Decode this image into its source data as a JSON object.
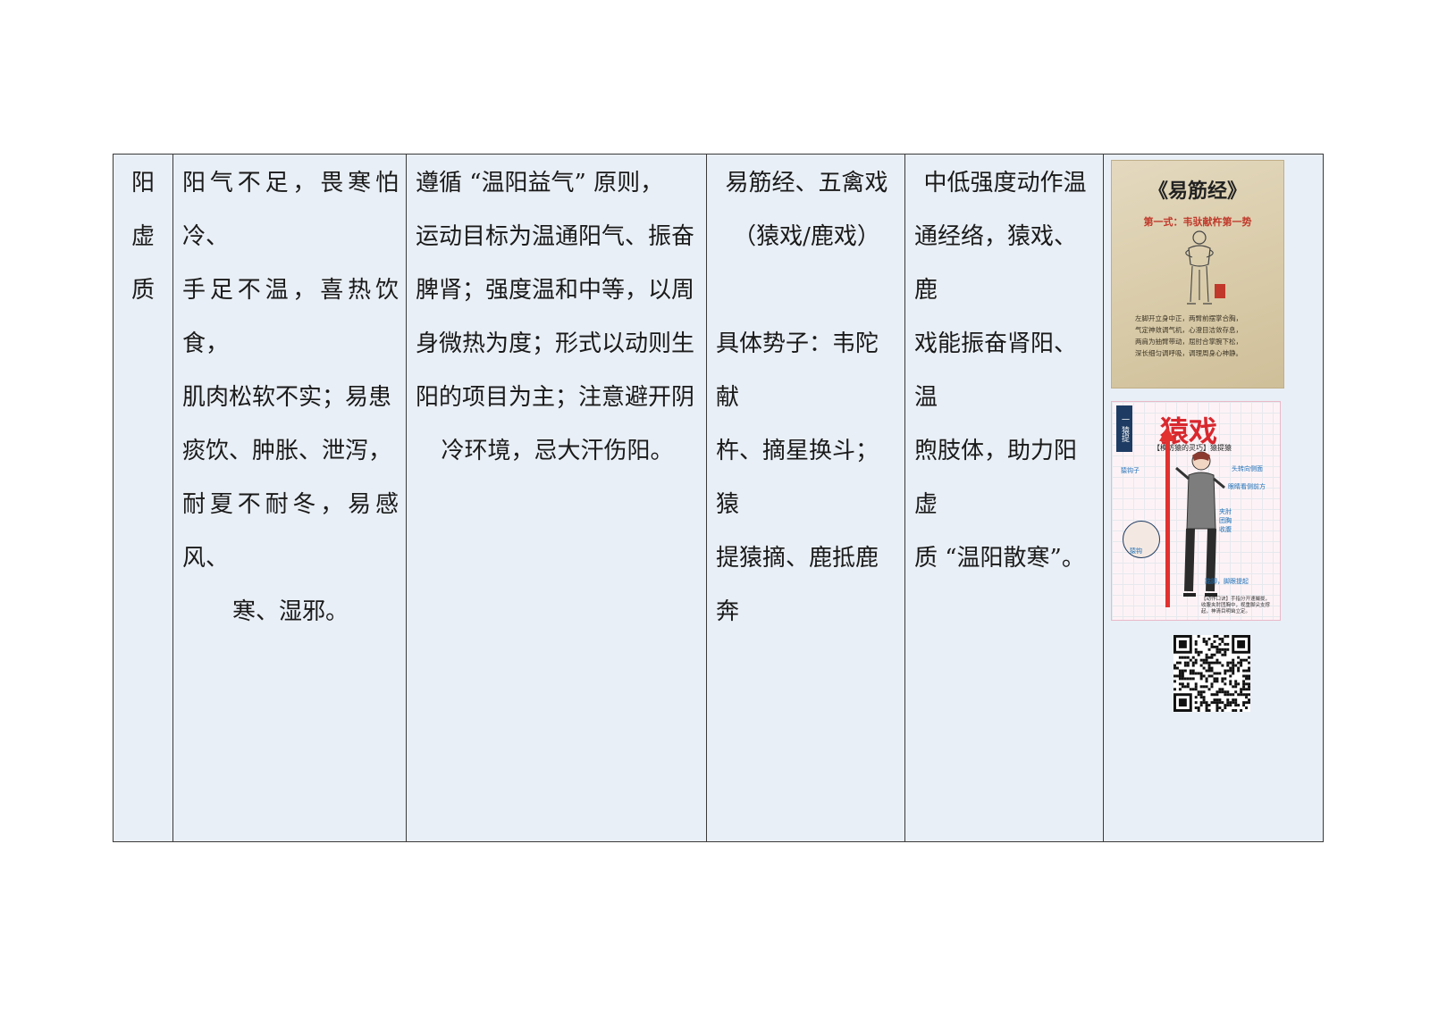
{
  "row": {
    "col1_chars": [
      "阳",
      "虚",
      "质"
    ],
    "col2_lines": [
      "阳气不足，畏寒怕冷、",
      "手足不温，喜热饮食，",
      "肌肉松软不实；易患",
      "痰饮、肿胀、泄泻，",
      "耐夏不耐冬，易感风、",
      "寒、湿邪。"
    ],
    "col3_lines": [
      "遵循 “温阳益气” 原则，",
      "运动目标为温通阳气、振奋",
      "脾肾；强度温和中等，以周",
      "身微热为度；形式以动则生",
      "阳的项目为主；注意避开阴",
      "冷环境，忌大汗伤阳。"
    ],
    "col4_top": [
      "易筋经、五禽戏",
      "（猿戏/鹿戏）"
    ],
    "col4_bottom": [
      "具体势子：韦陀献",
      "杵、摘星换斗；猿",
      "提猿摘、鹿抵鹿奔"
    ],
    "col5_lines": [
      "中低强度动作温",
      "通经络，猿戏、鹿",
      "戏能振奋肾阳、温",
      "煦肢体，助力阳虚",
      "质 “温阳散寒”。"
    ]
  },
  "images": {
    "yijinjing": {
      "title": "《易筋经》",
      "subtitle": "第一式：韦驮献杵第一势",
      "desc": [
        "左脚开立身中正，两臂前摆掌合胸，",
        "气定神敛调气机，心澄目洁敛存息，",
        "两肩为抽臂带动，屈肘合掌腕下松，",
        "深长细匀调呼吸，调理周身心神静。"
      ]
    },
    "yuanxi": {
      "badge": "一 猿提",
      "title": "猿戏",
      "subtitle": "【模仿猿的灵巧】猿提猿",
      "labels": [
        "猿钩子",
        "头转向侧面",
        "眼睛看侧前方",
        "夹肘",
        "团胸",
        "收腹",
        "猿钩",
        "踮脚，脚跟提起"
      ],
      "note": "【动作口诀】手指分开速撮拢，收腹夹肘团胸中，视重脚尖支撑起，神清目明耸立定。"
    },
    "qr_label": "qr-code"
  }
}
